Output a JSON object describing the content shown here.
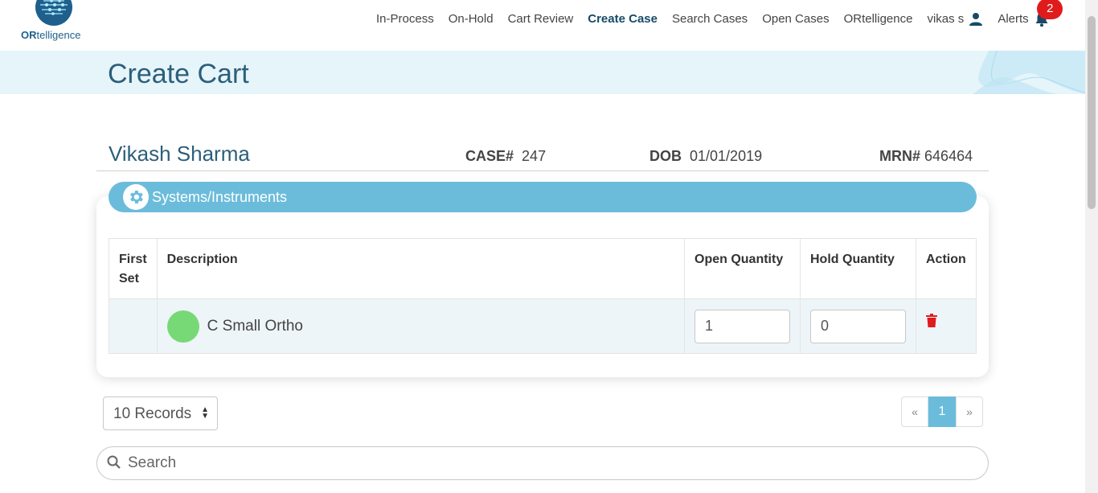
{
  "brand": {
    "logo_bold": "OR",
    "logo_rest": "telligence"
  },
  "nav": {
    "items": [
      {
        "label": "In-Process"
      },
      {
        "label": "On-Hold"
      },
      {
        "label": "Cart Review"
      },
      {
        "label": "Create Case",
        "active": true
      },
      {
        "label": "Search Cases"
      },
      {
        "label": "Open Cases"
      },
      {
        "label": "ORtelligence"
      }
    ],
    "user": "vikas s",
    "alerts": "Alerts",
    "alert_count": "2"
  },
  "page": {
    "title": "Create Cart"
  },
  "patient": {
    "name": "Vikash Sharma",
    "case_label": "CASE#",
    "case_value": "247",
    "dob_label": "DOB",
    "dob_value": "01/01/2019",
    "mrn_label": "MRN#",
    "mrn_value": "646464"
  },
  "section": {
    "title": "Systems/Instruments"
  },
  "table": {
    "headers": [
      "First Set",
      "Description",
      "Open Quantity",
      "Hold Quantity",
      "Action"
    ],
    "rows": [
      {
        "first_set": "",
        "description": "C Small Ortho",
        "open_qty": "1",
        "hold_qty": "0",
        "status_color": "#77d976"
      }
    ]
  },
  "records": {
    "selected": "10 Records"
  },
  "pagination": {
    "prev": "«",
    "current": "1",
    "next": "»"
  },
  "search": {
    "placeholder": "Search"
  },
  "colors": {
    "accent": "#6bbcdb",
    "title": "#2c5f7a",
    "alert": "#e01b1b",
    "delete": "#e01b1b"
  }
}
